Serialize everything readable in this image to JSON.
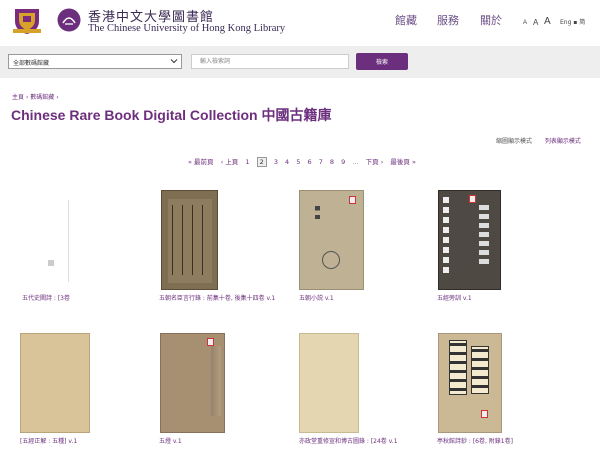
{
  "header": {
    "library_name_zh": "香港中文大學圖書館",
    "library_name_en": "The Chinese University of Hong Kong Library",
    "nav": [
      "館藏",
      "服務",
      "關於"
    ],
    "font_sizes": [
      "A",
      "A",
      "A"
    ],
    "lang_switch": "Eng ▪ 简"
  },
  "search": {
    "collection_select": "全部數碼館藏",
    "placeholder": "輸入檢索詞",
    "button": "檢索"
  },
  "breadcrumb": [
    "主頁",
    "數碼館藏"
  ],
  "page_title": "Chinese Rare Book Digital Collection 中國古籍庫",
  "view_modes": [
    "縮圖顯示模式",
    "列表顯示模式"
  ],
  "pagination": {
    "first": "« 最前頁",
    "prev": "‹ 上頁",
    "pages": [
      "1",
      "2",
      "3",
      "4",
      "5",
      "6",
      "7",
      "8",
      "9"
    ],
    "current": "2",
    "ellipsis": "...",
    "next": "下頁 ›",
    "last": "最後頁 »"
  },
  "books": [
    {
      "title": "五代史闕詩 : [3卷"
    },
    {
      "title": "五朝名臣言行錄 : 前集十卷, 後集十四卷 v.1"
    },
    {
      "title": "五朝小説 v.1"
    },
    {
      "title": "五經旁訓 v.1"
    },
    {
      "title": "[五經正解 : 五種] v.1"
    },
    {
      "title": "五燈 v.1"
    },
    {
      "title": "亦政堂重修宣和博古圖錄 : [24卷 v.1"
    },
    {
      "title": "亭秋館詩鈔 : [6卷, 附錄1卷]"
    }
  ],
  "colors": {
    "brand_purple": "#6c2f7e",
    "search_bar_bg": "#eeeeee"
  }
}
